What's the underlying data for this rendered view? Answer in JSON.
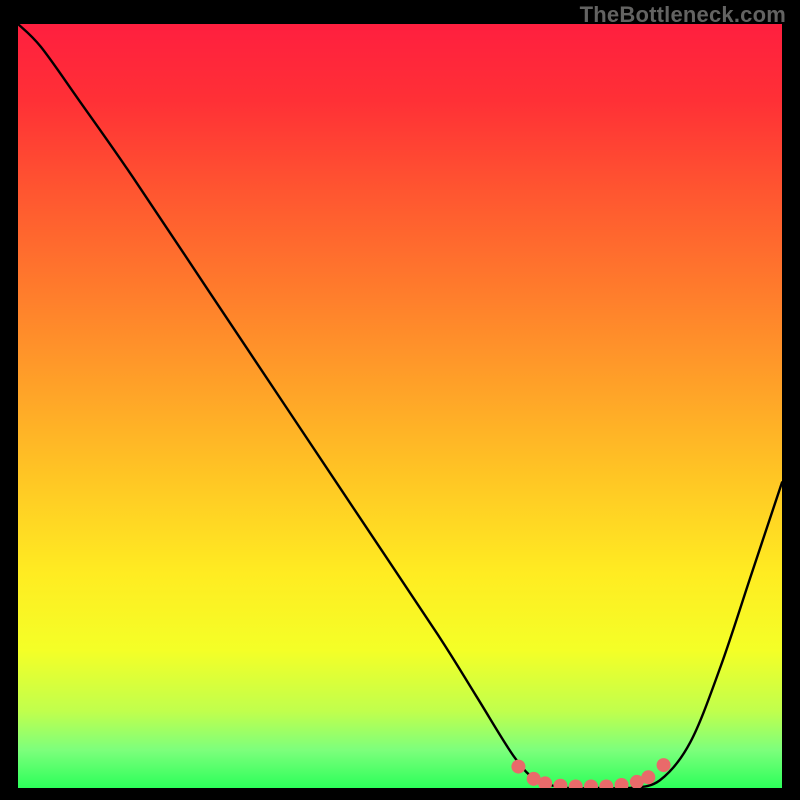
{
  "watermark": "TheBottleneck.com",
  "plot": {
    "inner_x": 18,
    "inner_y": 24,
    "inner_w": 764,
    "inner_h": 764
  },
  "gradient_stops": [
    {
      "offset": 0.0,
      "color": "#ff1f3f"
    },
    {
      "offset": 0.1,
      "color": "#ff3036"
    },
    {
      "offset": 0.22,
      "color": "#ff5630"
    },
    {
      "offset": 0.35,
      "color": "#ff7c2c"
    },
    {
      "offset": 0.48,
      "color": "#ffa328"
    },
    {
      "offset": 0.6,
      "color": "#ffc824"
    },
    {
      "offset": 0.72,
      "color": "#ffec22"
    },
    {
      "offset": 0.82,
      "color": "#f4ff27"
    },
    {
      "offset": 0.9,
      "color": "#c0ff4d"
    },
    {
      "offset": 0.95,
      "color": "#7dff7c"
    },
    {
      "offset": 1.0,
      "color": "#2cff5a"
    }
  ],
  "chart_data": {
    "type": "line",
    "title": "",
    "xlabel": "",
    "ylabel": "",
    "xlim": [
      0,
      100
    ],
    "ylim": [
      0,
      100
    ],
    "x": [
      0,
      3,
      8,
      15,
      25,
      35,
      45,
      55,
      60,
      65,
      68,
      72,
      76,
      80,
      84,
      88,
      92,
      96,
      100
    ],
    "values": [
      100,
      97,
      90,
      80,
      65,
      50,
      35,
      20,
      12,
      4,
      1,
      0,
      0,
      0,
      1,
      6,
      16,
      28,
      40
    ],
    "flat_min_range_x": [
      68,
      84
    ],
    "marker_cluster": {
      "xs": [
        65.5,
        67.5,
        69,
        71,
        73,
        75,
        77,
        79,
        81,
        82.5,
        84.5
      ],
      "ys": [
        2.8,
        1.2,
        0.6,
        0.3,
        0.2,
        0.2,
        0.2,
        0.4,
        0.8,
        1.4,
        3.0
      ],
      "color": "#e96a6a",
      "radius_px": 7
    },
    "annotations": []
  }
}
